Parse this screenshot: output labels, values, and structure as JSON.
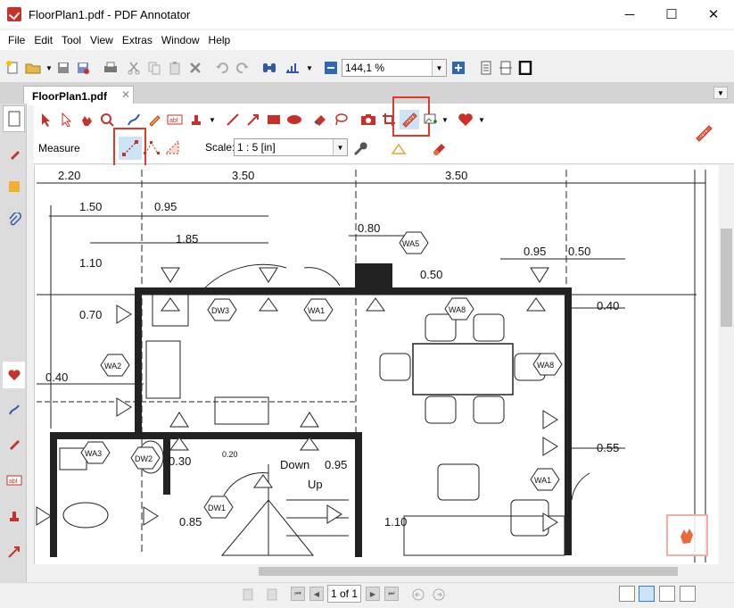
{
  "window": {
    "title": "FloorPlan1.pdf - PDF Annotator",
    "minimize": "─",
    "maximize": "☐",
    "close": "✕"
  },
  "menu": {
    "items": [
      "File",
      "Edit",
      "Tool",
      "View",
      "Extras",
      "Window",
      "Help"
    ]
  },
  "toolbar": {
    "zoom_value": "144,1 %"
  },
  "tabs": {
    "document_tab": "FloorPlan1.pdf",
    "close_glyph": "✕"
  },
  "annotation": {
    "measure_label": "Measure",
    "scale_label": "Scale:",
    "scale_value": "1 : 5 [in]"
  },
  "floorplan": {
    "dimensions": [
      "2.20",
      "3.50",
      "3.50",
      "1.50",
      "0.95",
      "1.85",
      "1.10",
      "0.70",
      "0.40",
      "0.80",
      "0.50",
      "0.95",
      "0.50",
      "0.40",
      "0.55",
      "0.30",
      "0.85",
      "0.95",
      "1.10",
      "0.20"
    ],
    "labels": [
      "WA5",
      "WA1",
      "DW3",
      "WA8",
      "WA8",
      "WA2",
      "WA3",
      "DW2",
      "DW1",
      "WA1",
      "Down",
      "Up"
    ]
  },
  "status": {
    "page_indicator": "1 of 1"
  },
  "colors": {
    "accent_red": "#c8312a",
    "highlight_box": "#e23a2a",
    "selected_blue": "#cce4f7"
  }
}
